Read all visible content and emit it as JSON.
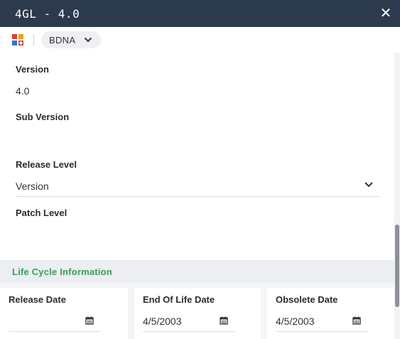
{
  "window": {
    "title": "4GL - 4.0",
    "close_icon": "close-icon",
    "accent_color": "#3a9c5c",
    "header_color": "#2c3a4d"
  },
  "toolbar": {
    "app_icon": "app-grid-icon",
    "source_label": "BDNA",
    "source_icon": "chevron-down-icon"
  },
  "fields": {
    "version": {
      "label": "Version",
      "value": "4.0"
    },
    "sub_version": {
      "label": "Sub Version",
      "value": ""
    },
    "release_level": {
      "label": "Release Level",
      "value": "Version"
    },
    "patch_level": {
      "label": "Patch Level",
      "value": ""
    }
  },
  "life_cycle": {
    "title": "Life Cycle Information",
    "release_date": {
      "label": "Release Date",
      "value": ""
    },
    "end_of_life_date": {
      "label": "End Of Life Date",
      "value": "4/5/2003"
    },
    "obsolete_date": {
      "label": "Obsolete Date",
      "value": "4/5/2003"
    },
    "calendar_icon": "calendar-icon"
  }
}
